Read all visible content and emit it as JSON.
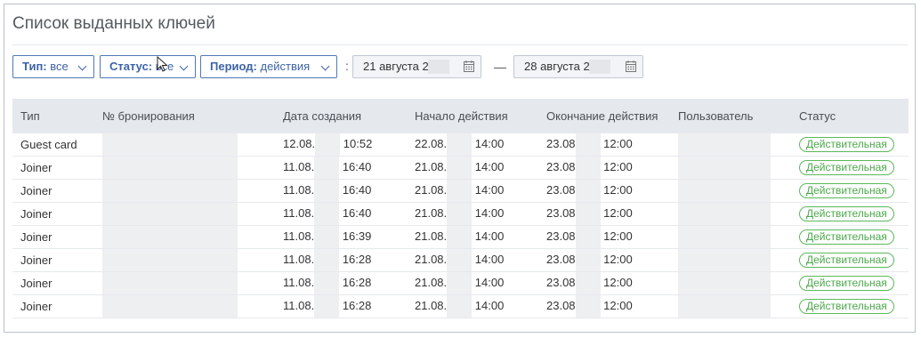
{
  "page": {
    "title": "Список выданных ключей"
  },
  "filters": {
    "type": {
      "label": "Тип:",
      "value": "все"
    },
    "status": {
      "label": "Статус:",
      "value": "все"
    },
    "period": {
      "label": "Период:",
      "value": "действия"
    },
    "colon": ":",
    "date_from": "21 августа 2",
    "date_to": "28 августа 2",
    "range_dash": "—"
  },
  "table": {
    "headers": [
      "Тип",
      "№ бронирования",
      "Дата создания",
      "Начало действия",
      "Окончание действия",
      "Пользователь",
      "Статус"
    ],
    "rows": [
      {
        "type": "Guest card",
        "created_date": "12.08.",
        "created_time": "10:52",
        "start_date": "22.08.",
        "start_time": "14:00",
        "end_date": "23.08",
        "end_time": "12:00",
        "status": "Действительная"
      },
      {
        "type": "Joiner",
        "created_date": "11.08.",
        "created_time": "16:40",
        "start_date": "21.08.",
        "start_time": "14:00",
        "end_date": "23.08",
        "end_time": "12:00",
        "status": "Действительная"
      },
      {
        "type": "Joiner",
        "created_date": "11.08.",
        "created_time": "16:40",
        "start_date": "21.08.",
        "start_time": "14:00",
        "end_date": "23.08",
        "end_time": "12:00",
        "status": "Действительная"
      },
      {
        "type": "Joiner",
        "created_date": "11.08.",
        "created_time": "16:40",
        "start_date": "21.08.",
        "start_time": "14:00",
        "end_date": "23.08",
        "end_time": "12:00",
        "status": "Действительная"
      },
      {
        "type": "Joiner",
        "created_date": "11.08.",
        "created_time": "16:39",
        "start_date": "21.08.",
        "start_time": "14:00",
        "end_date": "23.08",
        "end_time": "12:00",
        "status": "Действительная"
      },
      {
        "type": "Joiner",
        "created_date": "11.08.",
        "created_time": "16:28",
        "start_date": "21.08.",
        "start_time": "14:00",
        "end_date": "23.08",
        "end_time": "12:00",
        "status": "Действительная"
      },
      {
        "type": "Joiner",
        "created_date": "11.08.",
        "created_time": "16:28",
        "start_date": "21.08.",
        "start_time": "14:00",
        "end_date": "23.08",
        "end_time": "12:00",
        "status": "Действительная"
      },
      {
        "type": "Joiner",
        "created_date": "11.08.",
        "created_time": "16:28",
        "start_date": "21.08.",
        "start_time": "14:00",
        "end_date": "23.08",
        "end_time": "12:00",
        "status": "Действительная"
      }
    ]
  },
  "colors": {
    "accent": "#3d63a8",
    "status_green": "#4aa84a",
    "header_bg": "#e5e8ec"
  },
  "icons": {
    "calendar": "calendar-icon",
    "chevron": "chevron-down-icon",
    "cursor": "mouse-cursor-icon"
  }
}
